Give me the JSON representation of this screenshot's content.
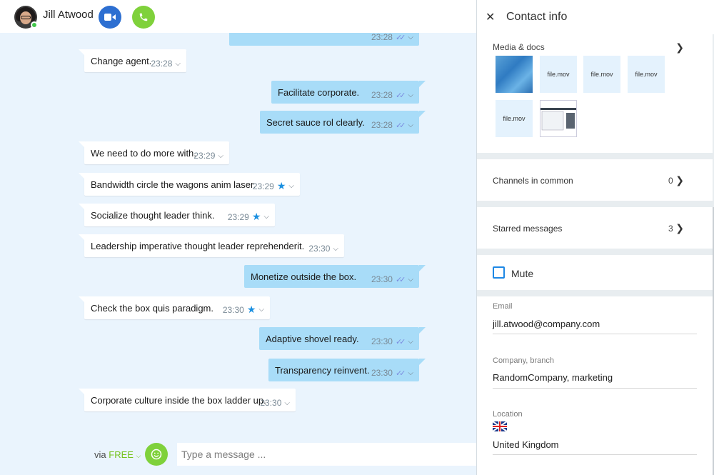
{
  "header": {
    "contact_name": "Jill Atwood",
    "video_icon": "video-camera-icon",
    "call_icon": "phone-icon"
  },
  "messages": [
    {
      "dir": "out",
      "text": "",
      "time": "23:28",
      "status": "read"
    },
    {
      "dir": "in",
      "text": "Change agent.",
      "time": "23:28"
    },
    {
      "dir": "out",
      "text": "Facilitate corporate.",
      "time": "23:28",
      "status": "read"
    },
    {
      "dir": "out",
      "text": "Secret sauce rol clearly.",
      "time": "23:28",
      "status": "read"
    },
    {
      "dir": "in",
      "text": "We need to do more with.",
      "time": "23:29"
    },
    {
      "dir": "in",
      "text": "Bandwidth circle the wagons anim laser.",
      "time": "23:29",
      "starred": true
    },
    {
      "dir": "in",
      "text": "Socialize thought leader think.",
      "time": "23:29",
      "starred": true
    },
    {
      "dir": "in",
      "text": "Leadership imperative thought leader reprehenderit.",
      "time": "23:30"
    },
    {
      "dir": "out",
      "text": "Monetize outside the box.",
      "time": "23:30",
      "status": "read"
    },
    {
      "dir": "in",
      "text": "Check the box quis paradigm.",
      "time": "23:30",
      "starred": true
    },
    {
      "dir": "out",
      "text": "Adaptive shovel ready.",
      "time": "23:30",
      "status": "read"
    },
    {
      "dir": "out",
      "text": "Transparency reinvent.",
      "time": "23:30",
      "status": "read"
    },
    {
      "dir": "in",
      "text": "Corporate culture inside the box ladder up.",
      "time": "23:30"
    }
  ],
  "composer": {
    "via_label": "via",
    "plan_label": "FREE",
    "placeholder": "Type a message ..."
  },
  "info": {
    "title": "Contact info",
    "media_label": "Media & docs",
    "media": [
      "image",
      "file.mov",
      "file.mov",
      "file.mov",
      "file.mov",
      "screenshot"
    ],
    "channels_label": "Channels in common",
    "channels_count": "0",
    "starred_label": "Starred messages",
    "starred_count": "3",
    "mute_label": "Mute",
    "email_label": "Email",
    "email_value": "jill.atwood@company.com",
    "company_label": "Company, branch",
    "company_value": "RandomCompany, marketing",
    "location_label": "Location",
    "location_flag": "uk-flag-icon",
    "location_value": "United Kingdom"
  },
  "colors": {
    "chat_bg": "#eaf4fd",
    "outgoing_bubble": "#a8dcf8",
    "incoming_bubble": "#ffffff",
    "video_btn": "#2d6fd1",
    "green_btn": "#7fd13b",
    "star": "#1a8fe0",
    "read_ticks": "#7b8be0"
  }
}
